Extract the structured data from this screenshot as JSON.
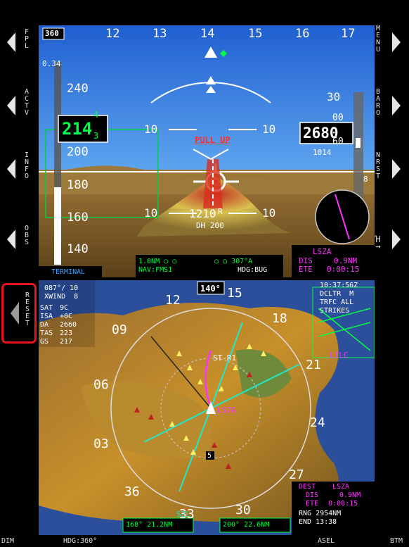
{
  "bezel_left": [
    {
      "label": "FPL"
    },
    {
      "label": "ACTV"
    },
    {
      "label": "INFO"
    },
    {
      "label": "OBS"
    },
    {
      "label": "RESET"
    }
  ],
  "bezel_right": [
    {
      "label": "MENU"
    },
    {
      "label": "BARO"
    },
    {
      "label": "NRST"
    },
    {
      "label": "Ή→"
    }
  ],
  "pfd": {
    "heading_box": "360",
    "heading_ticks": [
      "12",
      "13",
      "14",
      "15",
      "16",
      "17"
    ],
    "mach": "0.34",
    "airspeed_ticks": [
      "240",
      "200",
      "180",
      "160",
      "140"
    ],
    "airspeed_value": "214",
    "airspeed_roll_top": "4",
    "airspeed_roll_bottom": "3",
    "bank_left": "10",
    "bank_right": "10",
    "pitch_left": "10",
    "pitch_right": "10",
    "pull_up": "PULL UP",
    "altitude": "2680",
    "altitude_roll_top": "00",
    "altitude_roll_bottom": "60",
    "alt_tick_30": "30",
    "baro": "1014",
    "vs_8": "8",
    "radio_alt": "1210",
    "radio_alt_suffix": "R",
    "dh": "DH 200",
    "nav_line1": "1.0NM ○ ○",
    "nav_line1_right": "○ ○ 307°A",
    "nav_source": "NAV:FMS1",
    "hdg_source": "HDG:BUG",
    "terminal": "TERMINAL",
    "wpt_name": "LSZA",
    "wpt_dis_label": "DIS",
    "wpt_dis": "0.9NM",
    "wpt_ete_label": "ETE",
    "wpt_ete": "0:00:15"
  },
  "mfd": {
    "hdg_box": "140°",
    "wind_line1": "087°/ 10",
    "wind_line2": "XWIND  8",
    "sat_label": "SAT",
    "sat_val": "9C",
    "isa_label": "ISA",
    "isa_val": "+0C",
    "da_label": "DA",
    "da_val": "2660",
    "tas_label": "TAS",
    "tas_val": "223",
    "gs_label": "GS",
    "gs_val": "217",
    "time": "10:37:56Z",
    "declutter": "DCLTR  M",
    "traffic": "TRFC ALL",
    "strikes": "STRIKES",
    "lilc": "LILC",
    "compass_labels": [
      "12",
      "15",
      "18",
      "21",
      "24",
      "27",
      "30",
      "33",
      "36",
      "03",
      "06",
      "09"
    ],
    "str_label": "ST-R1",
    "lsza_label": "LSZA",
    "szl_label": "SZL",
    "five": "5",
    "dest_label": "DEST",
    "dest_name": "LSZA",
    "dest_dis_label": "DIS",
    "dest_dis": "0.9NM",
    "dest_ete_label": "ETE",
    "dest_ete": "0:00:15",
    "rng": "RNG 2954NM",
    "end": "END 13:38",
    "brg1": "168° 21.2NM",
    "brg2": "200° 22.6NM"
  },
  "bottom_bar": {
    "dim": "DIM",
    "hdg": "HDG:360°",
    "asel": "ASEL",
    "btm": "BTM"
  },
  "colors": {
    "sky": "#2e6fd8",
    "ground": "#8a6a2a",
    "magenta": "#ff33ff",
    "cyan": "#00e0ff",
    "green": "#00ff44",
    "reset_highlight": "#e8161c"
  }
}
